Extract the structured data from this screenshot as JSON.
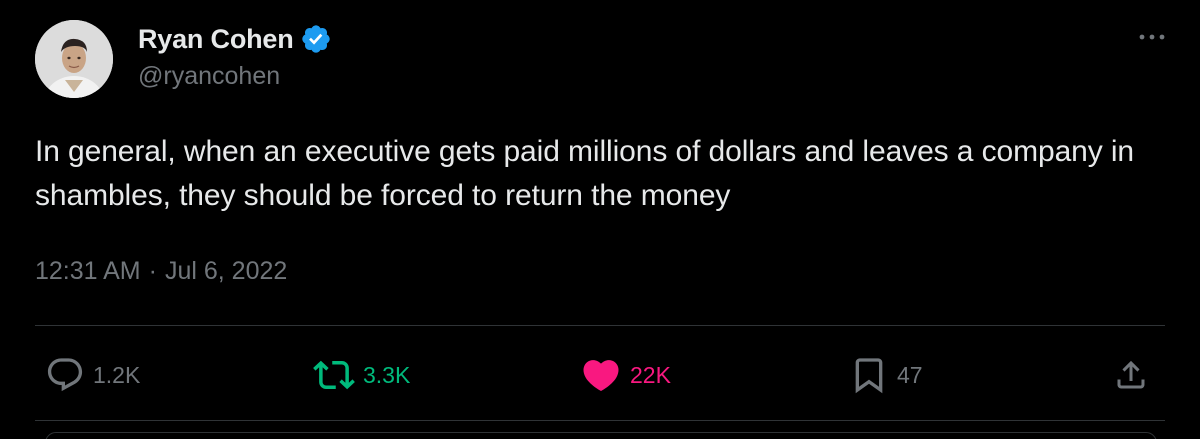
{
  "author": {
    "display_name": "Ryan Cohen",
    "handle": "@ryancohen",
    "verified": true,
    "verified_color": "#1d9bf0"
  },
  "tweet": {
    "text": "In general, when an executive gets paid millions of dollars and leaves a company in shambles, they should be forced to return the money",
    "time": "12:31 AM",
    "separator": "·",
    "date": "Jul 6, 2022"
  },
  "actions": {
    "reply": {
      "icon": "reply-icon",
      "count": "1.2K"
    },
    "retweet": {
      "icon": "retweet-icon",
      "count": "3.3K",
      "color": "#00ba7c"
    },
    "like": {
      "icon": "heart-icon",
      "count": "22K",
      "color": "#f91880",
      "liked": true
    },
    "bookmark": {
      "icon": "bookmark-icon",
      "count": "47"
    },
    "share": {
      "icon": "share-icon"
    }
  },
  "colors": {
    "background": "#000000",
    "text": "#e7e9ea",
    "secondary_text": "#71767b",
    "divider": "#2f3336"
  }
}
